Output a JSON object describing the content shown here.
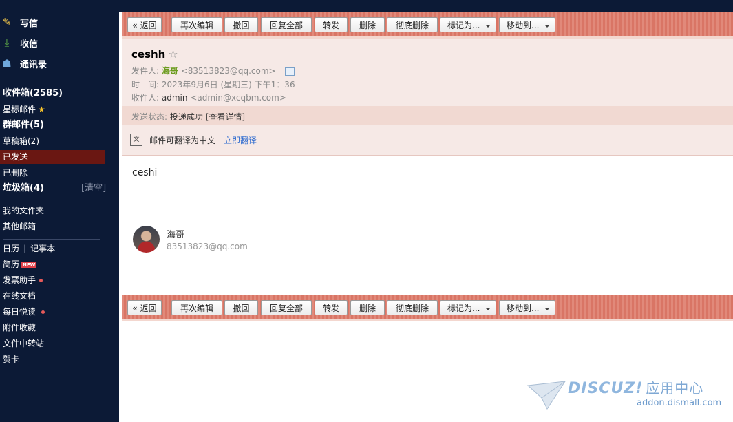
{
  "sidebar": {
    "compose": {
      "label": "写信",
      "icon": "pencil-icon"
    },
    "receive": {
      "label": "收信",
      "icon": "download-icon"
    },
    "contacts": {
      "label": "通讯录",
      "icon": "contact-card-icon"
    },
    "inbox": "收件箱(2585)",
    "starred": "星标邮件",
    "group": "群邮件(5)",
    "drafts": "草稿箱(2)",
    "sent": "已发送",
    "deleted": "已删除",
    "junk": "垃圾箱(4)",
    "junk_clear": "[清空]",
    "my_folders": "我的文件夹",
    "other_mail": "其他邮箱",
    "calendar": "日历",
    "pipe": "|",
    "notebook": "记事本",
    "resume": "简历",
    "resume_badge": "NEW",
    "invoice": "发票助手",
    "online_docs": "在线文档",
    "daily_read": "每日悦读",
    "attachments": "附件收藏",
    "file_transfer": "文件中转站",
    "card": "贺卡"
  },
  "toolbar": {
    "back": "« 返回",
    "reedit": "再次编辑",
    "recall": "撤回",
    "reply_all": "回复全部",
    "forward": "转发",
    "delete": "删除",
    "perm_delete": "彻底删除",
    "mark_as": "标记为...",
    "move_to": "移动到..."
  },
  "message": {
    "subject": "ceshh",
    "star": "☆",
    "from_label": "发件人:",
    "from_name": "海哥",
    "from_email": "<83513823@qq.com>",
    "time_label": "时　间:",
    "time_value": "2023年9月6日 (星期三) 下午1：36",
    "to_label": "收件人:",
    "to_name": "admin",
    "to_email": "<admin@xcqbm.com>",
    "status_label": "发送状态:",
    "status_value": "投递成功",
    "status_link": "[查看详情]",
    "translate_text": "邮件可翻译为中文",
    "translate_link": "立即翻译",
    "body": "ceshi",
    "sig_name": "海哥",
    "sig_email": "83513823@qq.com"
  },
  "watermark": {
    "brand": "DISCUZ!",
    "brand_cn": "应用中心",
    "url": "addon.dismall.com"
  },
  "colors": {
    "sidebar_bg": "#0c1a36",
    "active_item": "#6a1712",
    "toolbar_bg": "#dd7e6f",
    "header_bg": "#f6e9e6",
    "sender_name": "#6b9b1d",
    "link": "#2e6bcf"
  }
}
